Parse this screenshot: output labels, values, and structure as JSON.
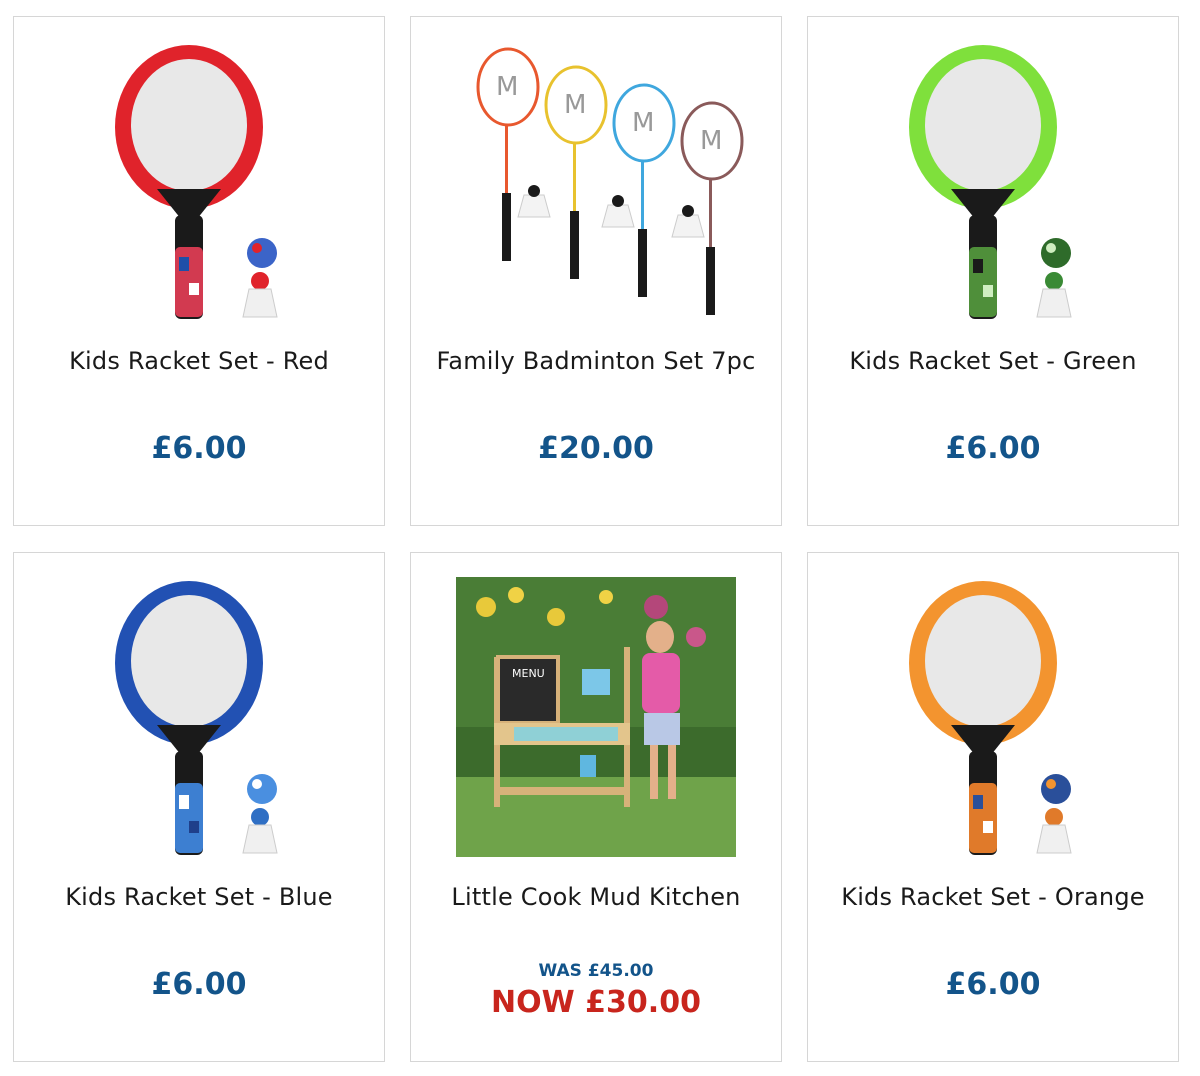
{
  "products": [
    {
      "title": "Kids Racket Set - Red",
      "price": "£6.00",
      "image": "red-racket-set",
      "color": "#e0232b"
    },
    {
      "title": "Family Badminton Set 7pc",
      "price": "£20.00",
      "image": "badminton-set"
    },
    {
      "title": "Kids Racket Set - Green",
      "price": "£6.00",
      "image": "green-racket-set",
      "color": "#7fe03c"
    },
    {
      "title": "Kids Racket Set - Blue",
      "price": "£6.00",
      "image": "blue-racket-set",
      "color": "#2251b3"
    },
    {
      "title": "Little Cook Mud Kitchen",
      "was": "WAS £45.00",
      "now": "NOW £30.00",
      "image": "mud-kitchen-photo"
    },
    {
      "title": "Kids Racket Set - Orange",
      "price": "£6.00",
      "image": "orange-racket-set",
      "color": "#f3942f"
    }
  ],
  "colors": {
    "price": "#13548a",
    "sale": "#c8251d"
  }
}
